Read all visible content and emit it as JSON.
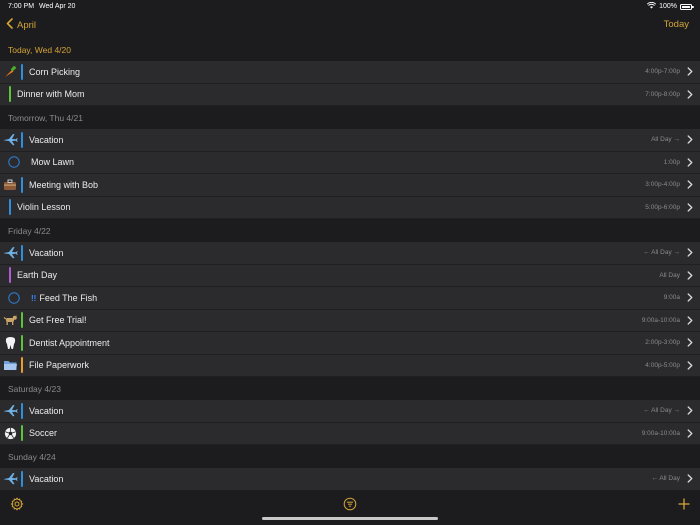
{
  "status_bar": {
    "time": "7:00 PM",
    "date": "Wed Apr 20",
    "battery": "100%"
  },
  "nav": {
    "back_label": "April",
    "today_label": "Today"
  },
  "colors": {
    "accent": "#d4a437",
    "blue": "#2d8fe0",
    "green": "#5cc43a",
    "purple": "#b05ad6",
    "orange": "#f09a2b"
  },
  "sections": [
    {
      "header": "Today, Wed 4/20",
      "is_today": true,
      "events": [
        {
          "title": "Corn Picking",
          "time": "4:00p-7:00p",
          "icon": "carrot-icon",
          "color": "#2d8fe0"
        },
        {
          "title": "Dinner with Mom",
          "time": "7:00p-8:00p",
          "icon": "",
          "color": "#5cc43a"
        }
      ]
    },
    {
      "header": "Tomorrow, Thu 4/21",
      "events": [
        {
          "title": "Vacation",
          "time": "All Day →",
          "icon": "airplane-icon",
          "color": "#2d8fe0"
        },
        {
          "title": "Mow Lawn",
          "time": "1:00p",
          "icon": "",
          "task": true,
          "color": ""
        },
        {
          "title": "Meeting with Bob",
          "time": "3:00p-4:00p",
          "icon": "briefcase-icon",
          "color": "#2d8fe0"
        },
        {
          "title": "Violin Lesson",
          "time": "5:00p-6:00p",
          "icon": "",
          "color": "#2d8fe0"
        }
      ]
    },
    {
      "header": "Friday 4/22",
      "events": [
        {
          "title": "Vacation",
          "time": "← All Day →",
          "icon": "airplane-icon",
          "color": "#2d8fe0"
        },
        {
          "title": "Earth Day",
          "time": "All Day",
          "icon": "",
          "color": "#b05ad6"
        },
        {
          "title": "Feed The Fish",
          "time": "9:00a",
          "icon": "",
          "task": true,
          "priority": "!!",
          "color": ""
        },
        {
          "title": "Get Free Trial!",
          "time": "9:00a-10:00a",
          "icon": "dog-icon",
          "color": "#5cc43a"
        },
        {
          "title": "Dentist Appointment",
          "time": "2:00p-3:00p",
          "icon": "tooth-icon",
          "color": "#5cc43a"
        },
        {
          "title": "File Paperwork",
          "time": "4:00p-5:00p",
          "icon": "folder-icon",
          "color": "#f09a2b"
        }
      ]
    },
    {
      "header": "Saturday 4/23",
      "events": [
        {
          "title": "Vacation",
          "time": "← All Day →",
          "icon": "airplane-icon",
          "color": "#2d8fe0"
        },
        {
          "title": "Soccer",
          "time": "9:00a-10:00a",
          "icon": "soccer-ball-icon",
          "color": "#5cc43a"
        }
      ]
    },
    {
      "header": "Sunday 4/24",
      "events": [
        {
          "title": "Vacation",
          "time": "← All Day",
          "icon": "airplane-icon",
          "color": "#2d8fe0"
        }
      ]
    }
  ],
  "toolbar": {
    "settings_icon": "gear-icon",
    "filter_icon": "filter-icon",
    "add_icon": "plus-icon"
  }
}
